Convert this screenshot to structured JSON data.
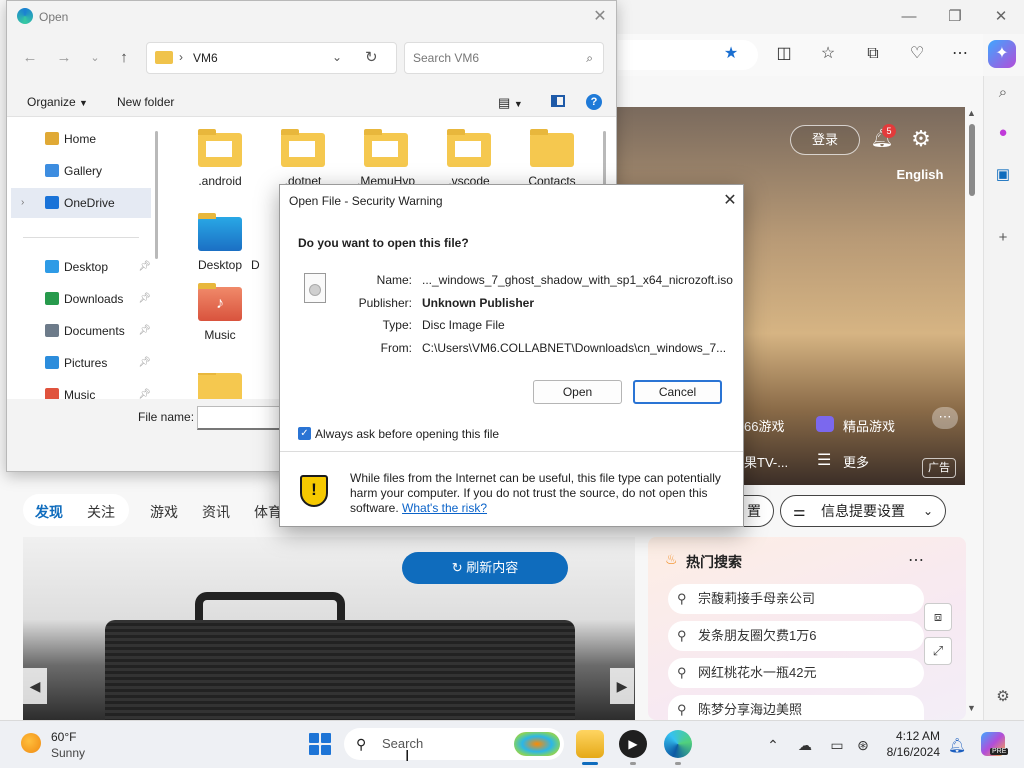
{
  "explorer": {
    "title": "Open",
    "path": "VM6",
    "search_placeholder": "Search VM6",
    "organize_label": "Organize",
    "new_folder_label": "New folder",
    "nav_items": [
      {
        "label": "Home",
        "icon": "home-icon",
        "color": "#e0a935"
      },
      {
        "label": "Gallery",
        "icon": "gallery-icon",
        "color": "#3d8de0"
      },
      {
        "label": "OneDrive",
        "icon": "onedrive-icon",
        "color": "#1a73d8"
      },
      {
        "label": "Desktop",
        "icon": "desktop-icon",
        "color": "#2e9be6"
      },
      {
        "label": "Downloads",
        "icon": "downloads-icon",
        "color": "#279a4c"
      },
      {
        "label": "Documents",
        "icon": "documents-icon",
        "color": "#6d7b8a"
      },
      {
        "label": "Pictures",
        "icon": "pictures-icon",
        "color": "#2c8ddc"
      },
      {
        "label": "Music",
        "icon": "music-icon",
        "color": "#e0533d"
      }
    ],
    "files": [
      {
        "label": ".android"
      },
      {
        "label": ".dotnet"
      },
      {
        "label": ".MemuHyp"
      },
      {
        "label": ".vscode"
      },
      {
        "label": "Contacts"
      },
      {
        "label": "Desktop"
      },
      {
        "label": "D"
      },
      {
        "label": "Music"
      },
      {
        "label": ""
      }
    ],
    "file_name_label": "File name:"
  },
  "warning": {
    "title": "Open File - Security Warning",
    "question": "Do you want to open this file?",
    "name_label": "Name:",
    "name_value": "..._windows_7_ghost_shadow_with_sp1_x64_nicrozoft.iso",
    "publisher_label": "Publisher:",
    "publisher_value": "Unknown Publisher",
    "type_label": "Type:",
    "type_value": "Disc Image File",
    "from_label": "From:",
    "from_value": "C:\\Users\\VM6.COLLABNET\\Downloads\\cn_windows_7...",
    "open_label": "Open",
    "cancel_label": "Cancel",
    "always_ask_label": "Always ask before opening this file",
    "always_ask_checked": true,
    "message": "While files from the Internet can be useful, this file type can potentially harm your computer. If you do not trust the source, do not open this software.",
    "risk_link": "What's the risk?"
  },
  "browser": {
    "login_label": "登录",
    "notification_count": "5",
    "language_label": "English",
    "hero_items": [
      "66游戏",
      "精品游戏",
      "果TV-...",
      "更多"
    ],
    "ad_label": "广告",
    "feed_tabs": [
      "发现",
      "关注",
      "游戏",
      "资讯",
      "体育"
    ],
    "settings_label_partial": "置",
    "digest_settings_label": "信息提要设置",
    "refresh_label": "刷新内容",
    "hot_search_title": "热门搜索",
    "hot_searches": [
      "宗馥莉接手母亲公司",
      "发条朋友圈欠费1万6",
      "网红桃花水一瓶42元",
      "陈梦分享海边美照"
    ]
  },
  "taskbar": {
    "temperature": "60°F",
    "condition": "Sunny",
    "search_placeholder": "Search",
    "time": "4:12 AM",
    "date": "8/16/2024",
    "copilot_tag": "PRE"
  }
}
